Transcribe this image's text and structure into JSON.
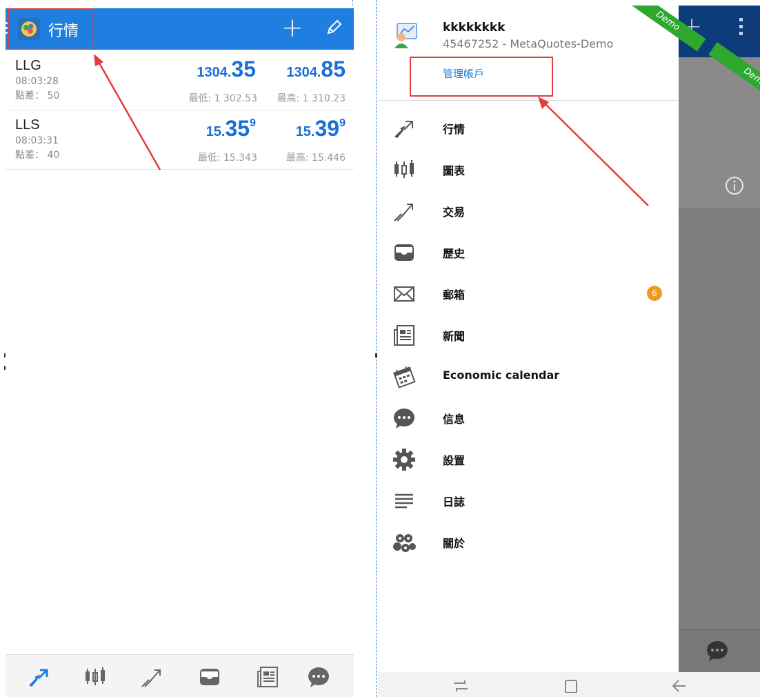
{
  "left": {
    "header": {
      "title": "行情"
    },
    "quotes": [
      {
        "symbol": "LLG",
        "time": "08:03:28",
        "spread": "點差： 50",
        "bid_small": "1304.",
        "bid_big": "35",
        "bid_sup": "",
        "ask_small": "1304.",
        "ask_big": "85",
        "ask_sup": "",
        "low": "最低: 1 302.53",
        "high": "最高: 1 310.23"
      },
      {
        "symbol": "LLS",
        "time": "08:03:31",
        "spread": "點差： 40",
        "bid_small": "15.",
        "bid_big": "35",
        "bid_sup": "9",
        "ask_small": "15.",
        "ask_big": "39",
        "ask_sup": "9",
        "low": "最低: 15.343",
        "high": "最高: 15.446"
      }
    ]
  },
  "right": {
    "account": {
      "name": "kkkkkkkk",
      "id": "45467252 - MetaQuotes-Demo",
      "manage": "管理帳戶"
    },
    "ribbon": "Demo",
    "menu": [
      {
        "label": "行情",
        "icon": "quotes-icon"
      },
      {
        "label": "圖表",
        "icon": "chart-icon"
      },
      {
        "label": "交易",
        "icon": "trade-icon"
      },
      {
        "label": "歷史",
        "icon": "history-icon"
      },
      {
        "label": "郵箱",
        "icon": "mail-icon",
        "badge": "6"
      },
      {
        "label": "新聞",
        "icon": "news-icon"
      },
      {
        "label": "Economic calendar",
        "icon": "calendar-icon"
      },
      {
        "label": "信息",
        "icon": "chat-icon"
      },
      {
        "label": "設置",
        "icon": "gear-icon"
      },
      {
        "label": "日誌",
        "icon": "journal-icon"
      },
      {
        "label": "關於",
        "icon": "about-icon"
      }
    ]
  },
  "colors": {
    "accent": "#1e7fe0",
    "price": "#1a6fd6",
    "highlight": "#e33c3c",
    "badge": "#f09a1e",
    "ribbon": "#2ea82e"
  }
}
